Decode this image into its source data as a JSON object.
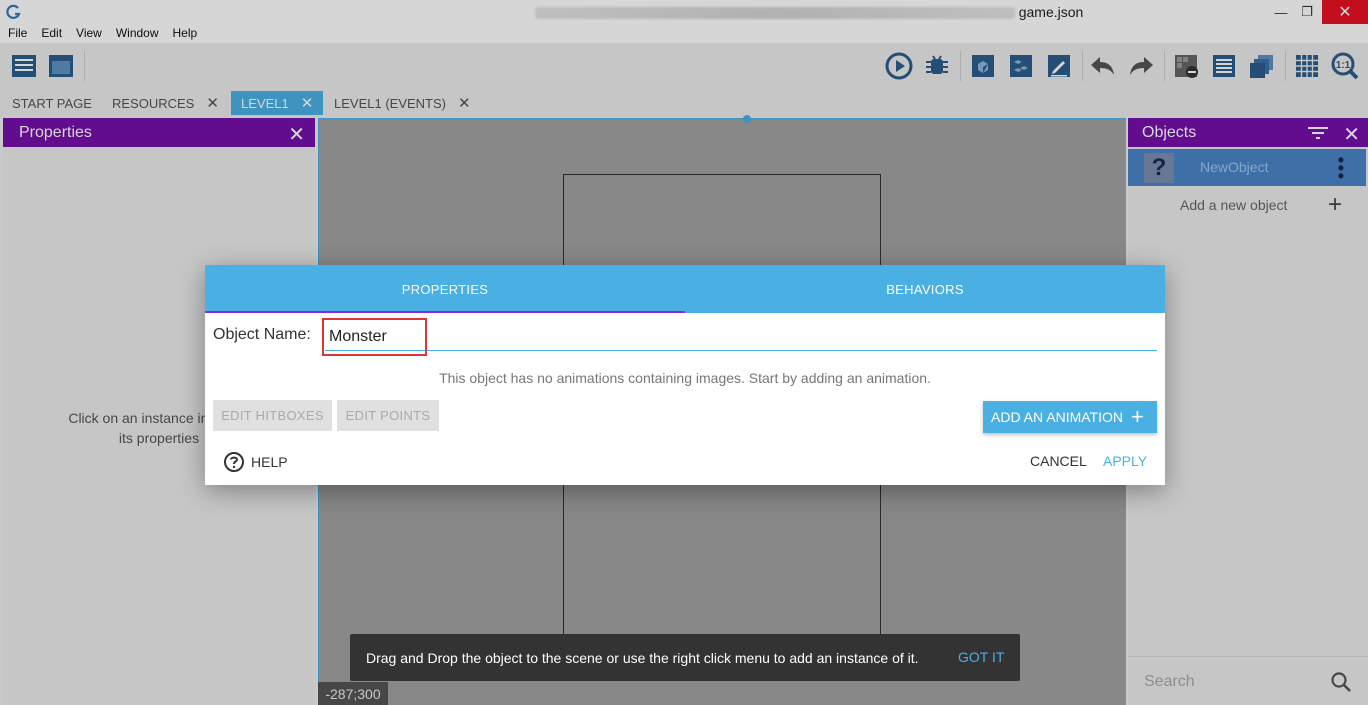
{
  "window": {
    "title": "game.json",
    "minimize": "—",
    "maximize": "❐",
    "close": "✕"
  },
  "menu": [
    "File",
    "Edit",
    "View",
    "Window",
    "Help"
  ],
  "tabs": [
    {
      "label": "START PAGE",
      "closable": false
    },
    {
      "label": "RESOURCES",
      "closable": true
    },
    {
      "label": "LEVEL1",
      "closable": true,
      "active": true
    },
    {
      "label": "LEVEL1 (EVENTS)",
      "closable": true
    }
  ],
  "tab_close": "✕",
  "properties_panel": {
    "title": "Properties",
    "close": "✕",
    "hint_line1": "Click on an instance in the sc",
    "hint_line2": "its properties"
  },
  "objects_panel": {
    "title": "Objects",
    "close": "✕",
    "object": {
      "name": "NewObject",
      "icon_glyph": "?",
      "more": "⋮"
    },
    "add_label": "Add a new object",
    "add_plus": "+",
    "search_placeholder": "Search"
  },
  "scene": {
    "coords": "-287;300"
  },
  "dialog": {
    "tabs": [
      "PROPERTIES",
      "BEHAVIORS"
    ],
    "name_label": "Object Name:",
    "name_value": "Monster",
    "info": "This object has no animations containing images. Start by adding an animation.",
    "edit_hitboxes": "EDIT HITBOXES",
    "edit_points": "EDIT POINTS",
    "add_animation": "ADD AN ANIMATION",
    "add_plus": "+",
    "help": "HELP",
    "cancel": "CANCEL",
    "apply": "APPLY"
  },
  "snackbar": {
    "message": "Drag and Drop the object to the scene or use the right click menu to add an instance of it.",
    "action": "GOT IT"
  },
  "colors": {
    "accent": "#4ab0e4",
    "panel_header": "#7510a8",
    "selected_row": "#4a86c8",
    "highlight": "#e03535"
  }
}
